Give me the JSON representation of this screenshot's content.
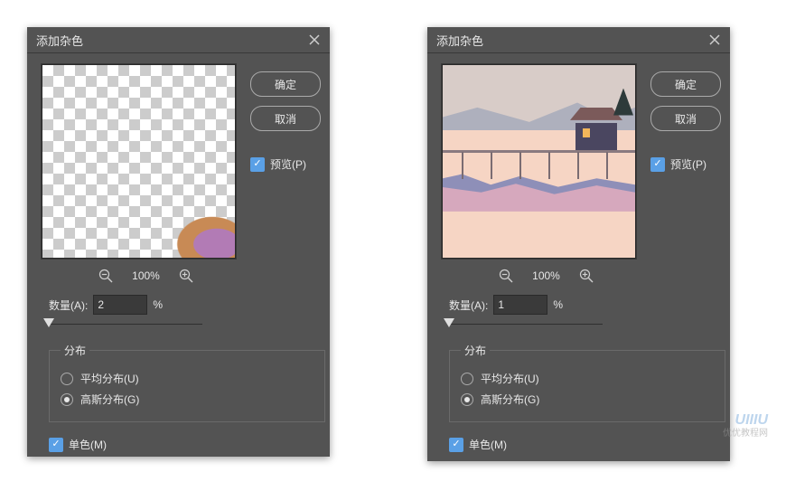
{
  "dialog_left": {
    "title": "添加杂色",
    "buttons": {
      "ok": "确定",
      "cancel": "取消"
    },
    "preview_checkbox": {
      "label": "预览(P)",
      "checked": true
    },
    "zoom_value": "100%",
    "amount": {
      "label": "数量(A):",
      "value": "2",
      "unit": "%"
    },
    "distribution": {
      "legend": "分布",
      "options": {
        "uniform": {
          "label": "平均分布(U)",
          "selected": false
        },
        "gaussian": {
          "label": "高斯分布(G)",
          "selected": true
        }
      }
    },
    "mono": {
      "label": "单色(M)",
      "checked": true
    }
  },
  "dialog_right": {
    "title": "添加杂色",
    "buttons": {
      "ok": "确定",
      "cancel": "取消"
    },
    "preview_checkbox": {
      "label": "预览(P)",
      "checked": true
    },
    "zoom_value": "100%",
    "amount": {
      "label": "数量(A):",
      "value": "1",
      "unit": "%"
    },
    "distribution": {
      "legend": "分布",
      "options": {
        "uniform": {
          "label": "平均分布(U)",
          "selected": false
        },
        "gaussian": {
          "label": "高斯分布(G)",
          "selected": true
        }
      }
    },
    "mono": {
      "label": "单色(M)",
      "checked": true
    }
  },
  "watermark": {
    "line1": "UIIIU",
    "line2": "优优教程网"
  }
}
